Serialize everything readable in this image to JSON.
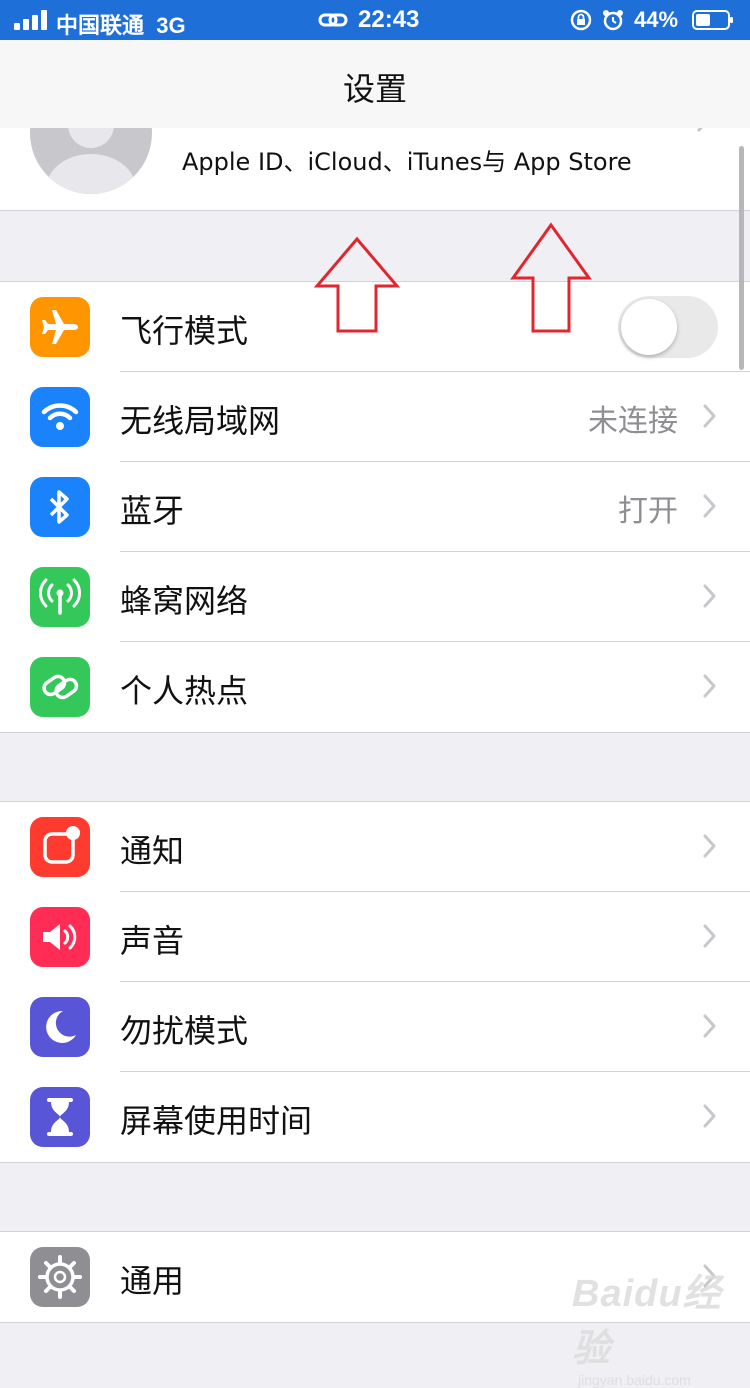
{
  "status_bar": {
    "carrier": "中国联通",
    "network": "3G",
    "time": "22:43",
    "battery_percent": "44%"
  },
  "nav": {
    "title": "设置"
  },
  "profile": {
    "subtitle": "Apple ID、iCloud、iTunes与 App Store"
  },
  "groups": [
    {
      "items": [
        {
          "label": "飞行模式",
          "icon": "airplane-icon",
          "color": "#ff9500",
          "toggle": false
        },
        {
          "label": "无线局域网",
          "icon": "wifi-icon",
          "color": "#1a82fb",
          "value": "未连接"
        },
        {
          "label": "蓝牙",
          "icon": "bluetooth-icon",
          "color": "#1a82fb",
          "value": "打开"
        },
        {
          "label": "蜂窝网络",
          "icon": "antenna-icon",
          "color": "#34c759"
        },
        {
          "label": "个人热点",
          "icon": "hotspot-icon",
          "color": "#34c759"
        }
      ]
    },
    {
      "items": [
        {
          "label": "通知",
          "icon": "notification-icon",
          "color": "#ff3b30"
        },
        {
          "label": "声音",
          "icon": "speaker-icon",
          "color": "#ff2d55"
        },
        {
          "label": "勿扰模式",
          "icon": "moon-icon",
          "color": "#5856d6"
        },
        {
          "label": "屏幕使用时间",
          "icon": "hourglass-icon",
          "color": "#5856d6"
        }
      ]
    },
    {
      "items": [
        {
          "label": "通用",
          "icon": "gear-icon",
          "color": "#8e8e93"
        }
      ]
    }
  ],
  "annotation_color": "#e0262e",
  "watermark": {
    "brand": "Baidu经验",
    "url": "jingyan.baidu.com"
  }
}
